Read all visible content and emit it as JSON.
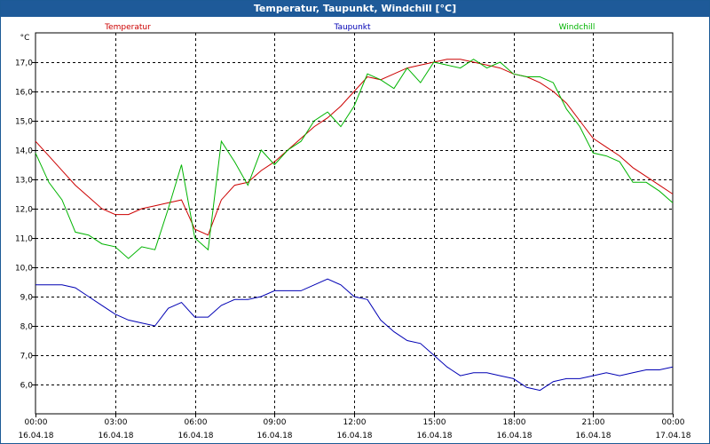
{
  "title": "Temperatur, Taupunkt, Windchill [°C]",
  "colors": {
    "title_bg": "#1e5a99",
    "title_text": "#ffffff",
    "temperature": "#cc0000",
    "dewpoint": "#0000b4",
    "windchill": "#00b400",
    "grid": "#000000"
  },
  "chart_data": {
    "type": "line",
    "title": "Temperatur, Taupunkt, Windchill [°C]",
    "ylabel": "°C",
    "xlabel": "",
    "ylim": [
      5.0,
      18.0
    ],
    "xlim": [
      0,
      24
    ],
    "y_ticks": [
      "6,0",
      "7,0",
      "8,0",
      "9,0",
      "10,0",
      "11,0",
      "12,0",
      "13,0",
      "14,0",
      "15,0",
      "16,0",
      "17,0"
    ],
    "y_tick_values": [
      6,
      7,
      8,
      9,
      10,
      11,
      12,
      13,
      14,
      15,
      16,
      17
    ],
    "x_ticks": [
      {
        "x": 0,
        "time": "00:00",
        "date": "16.04.18"
      },
      {
        "x": 3,
        "time": "03:00",
        "date": "16.04.18"
      },
      {
        "x": 6,
        "time": "06:00",
        "date": "16.04.18"
      },
      {
        "x": 9,
        "time": "09:00",
        "date": "16.04.18"
      },
      {
        "x": 12,
        "time": "12:00",
        "date": "16.04.18"
      },
      {
        "x": 15,
        "time": "15:00",
        "date": "16.04.18"
      },
      {
        "x": 18,
        "time": "18:00",
        "date": "16.04.18"
      },
      {
        "x": 21,
        "time": "21:00",
        "date": "16.04.18"
      },
      {
        "x": 24,
        "time": "00:00",
        "date": "17.04.18"
      }
    ],
    "grid": true,
    "legend_position": "top",
    "series": [
      {
        "name": "Temperatur",
        "color": "#cc0000",
        "x": [
          0,
          0.5,
          1,
          1.5,
          2,
          2.5,
          3,
          3.5,
          4,
          4.5,
          5,
          5.5,
          6,
          6.5,
          7,
          7.5,
          8,
          8.5,
          9,
          9.5,
          10,
          10.5,
          11,
          11.5,
          12,
          12.5,
          13,
          13.5,
          14,
          14.5,
          15,
          15.5,
          16,
          16.5,
          17,
          17.5,
          18,
          18.5,
          19,
          19.5,
          20,
          20.5,
          21,
          21.5,
          22,
          22.5,
          23,
          23.5,
          24
        ],
        "values": [
          14.3,
          13.8,
          13.3,
          12.8,
          12.4,
          12.0,
          11.8,
          11.8,
          12.0,
          12.1,
          12.2,
          12.3,
          11.3,
          11.1,
          12.3,
          12.8,
          12.9,
          13.3,
          13.6,
          14.0,
          14.4,
          14.8,
          15.1,
          15.5,
          16.0,
          16.5,
          16.4,
          16.6,
          16.8,
          16.9,
          17.0,
          17.1,
          17.1,
          17.0,
          16.9,
          16.8,
          16.6,
          16.5,
          16.3,
          16.0,
          15.6,
          15.0,
          14.4,
          14.1,
          13.8,
          13.4,
          13.1,
          12.8,
          12.5
        ]
      },
      {
        "name": "Taupunkt",
        "color": "#0000b4",
        "x": [
          0,
          0.5,
          1,
          1.5,
          2,
          2.5,
          3,
          3.5,
          4,
          4.5,
          5,
          5.5,
          6,
          6.5,
          7,
          7.5,
          8,
          8.5,
          9,
          9.5,
          10,
          10.5,
          11,
          11.5,
          12,
          12.5,
          13,
          13.5,
          14,
          14.5,
          15,
          15.5,
          16,
          16.5,
          17,
          17.5,
          18,
          18.5,
          19,
          19.5,
          20,
          20.5,
          21,
          21.5,
          22,
          22.5,
          23,
          23.5,
          24
        ],
        "values": [
          9.4,
          9.4,
          9.4,
          9.3,
          9.0,
          8.7,
          8.4,
          8.2,
          8.1,
          8.0,
          8.6,
          8.8,
          8.3,
          8.3,
          8.7,
          8.9,
          8.9,
          9.0,
          9.2,
          9.2,
          9.2,
          9.4,
          9.6,
          9.4,
          9.0,
          8.9,
          8.2,
          7.8,
          7.5,
          7.4,
          7.0,
          6.6,
          6.3,
          6.4,
          6.4,
          6.3,
          6.2,
          5.9,
          5.8,
          6.1,
          6.2,
          6.2,
          6.3,
          6.4,
          6.3,
          6.4,
          6.5,
          6.5,
          6.6
        ]
      },
      {
        "name": "Windchill",
        "color": "#00b400",
        "x": [
          0,
          0.5,
          1,
          1.5,
          2,
          2.5,
          3,
          3.5,
          4,
          4.5,
          5,
          5.5,
          6,
          6.5,
          7,
          7.5,
          8,
          8.5,
          9,
          9.5,
          10,
          10.5,
          11,
          11.5,
          12,
          12.5,
          13,
          13.5,
          14,
          14.5,
          15,
          15.5,
          16,
          16.5,
          17,
          17.5,
          18,
          18.5,
          19,
          19.5,
          20,
          20.5,
          21,
          21.5,
          22,
          22.5,
          23,
          23.5,
          24
        ],
        "values": [
          13.9,
          12.9,
          12.3,
          11.2,
          11.1,
          10.8,
          10.7,
          10.3,
          10.7,
          10.6,
          12.0,
          13.5,
          11.0,
          10.6,
          14.3,
          13.6,
          12.8,
          14.0,
          13.5,
          14.0,
          14.3,
          15.0,
          15.3,
          14.8,
          15.5,
          16.6,
          16.4,
          16.1,
          16.8,
          16.3,
          17.0,
          16.9,
          16.8,
          17.1,
          16.8,
          17.0,
          16.6,
          16.5,
          16.5,
          16.3,
          15.4,
          14.8,
          13.9,
          13.8,
          13.6,
          12.9,
          12.9,
          12.6,
          12.2
        ]
      }
    ]
  }
}
